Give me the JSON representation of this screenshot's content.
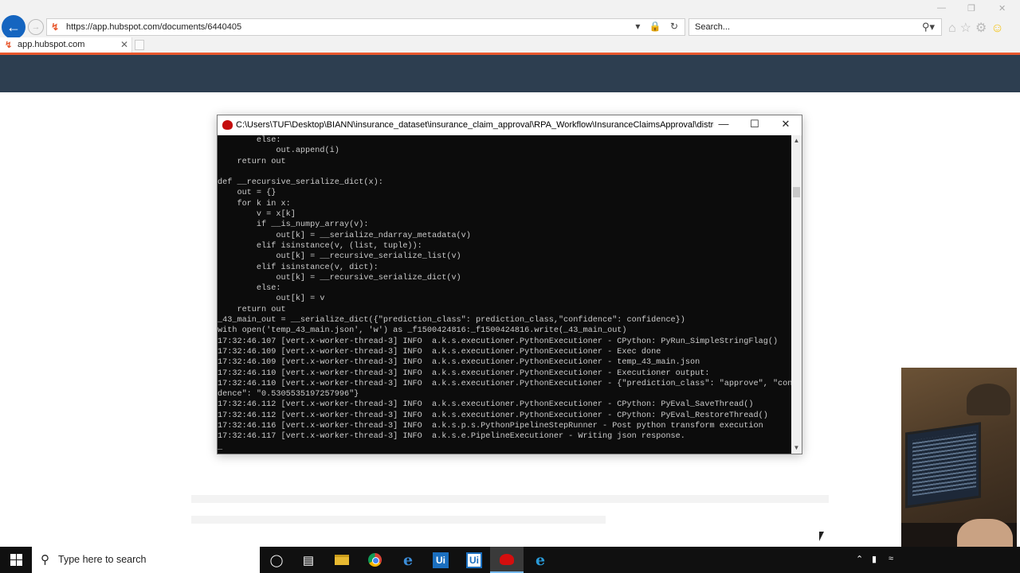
{
  "browser": {
    "url": "https://app.hubspot.com/documents/6440405",
    "search_placeholder": "Search...",
    "tab_label": "app.hubspot.com"
  },
  "console": {
    "title": "C:\\Users\\TUF\\Desktop\\BIANN\\insurance_dataset\\insurance_claim_approval\\RPA_Workflow\\InsuranceClaimsApproval\\distro\\jdk\\bin\\j...",
    "lines": [
      "        else:",
      "            out.append(i)",
      "    return out",
      "",
      "def __recursive_serialize_dict(x):",
      "    out = {}",
      "    for k in x:",
      "        v = x[k]",
      "        if __is_numpy_array(v):",
      "            out[k] = __serialize_ndarray_metadata(v)",
      "        elif isinstance(v, (list, tuple)):",
      "            out[k] = __recursive_serialize_list(v)",
      "        elif isinstance(v, dict):",
      "            out[k] = __recursive_serialize_dict(v)",
      "        else:",
      "            out[k] = v",
      "    return out",
      "_43_main_out = __serialize_dict({\"prediction_class\": prediction_class,\"confidence\": confidence})",
      "with open('temp_43_main.json', 'w') as _f1500424816:_f1500424816.write(_43_main_out)",
      "17:32:46.107 [vert.x-worker-thread-3] INFO  a.k.s.executioner.PythonExecutioner - CPython: PyRun_SimpleStringFlag()",
      "17:32:46.109 [vert.x-worker-thread-3] INFO  a.k.s.executioner.PythonExecutioner - Exec done",
      "17:32:46.109 [vert.x-worker-thread-3] INFO  a.k.s.executioner.PythonExecutioner - temp_43_main.json",
      "17:32:46.110 [vert.x-worker-thread-3] INFO  a.k.s.executioner.PythonExecutioner - Executioner output:",
      "17:32:46.110 [vert.x-worker-thread-3] INFO  a.k.s.executioner.PythonExecutioner - {\"prediction_class\": \"approve\", \"confi",
      "dence\": \"0.5305535197257996\"}",
      "17:32:46.112 [vert.x-worker-thread-3] INFO  a.k.s.executioner.PythonExecutioner - CPython: PyEval_SaveThread()",
      "17:32:46.112 [vert.x-worker-thread-3] INFO  a.k.s.executioner.PythonExecutioner - CPython: PyEval_RestoreThread()",
      "17:32:46.116 [vert.x-worker-thread-3] INFO  a.k.s.p.s.PythonPipelineStepRunner - Post python transform execution",
      "17:32:46.117 [vert.x-worker-thread-3] INFO  a.k.s.e.PipelineExecutioner - Writing json response.",
      "_"
    ]
  },
  "taskbar": {
    "search_placeholder": "Type here to search",
    "icons": [
      "cortana-icon",
      "task-view-icon",
      "file-explorer-icon",
      "chrome-icon",
      "edge-icon",
      "uipath-studio-icon",
      "uipath-robot-icon",
      "java-console-icon",
      "internet-explorer-icon"
    ]
  },
  "colors": {
    "hubspot_nav": "#2d3e50",
    "hubspot_accent": "#e8582e",
    "console_bg": "#0c0c0c",
    "console_text": "#cccccc",
    "taskbar_bg": "#101010"
  }
}
